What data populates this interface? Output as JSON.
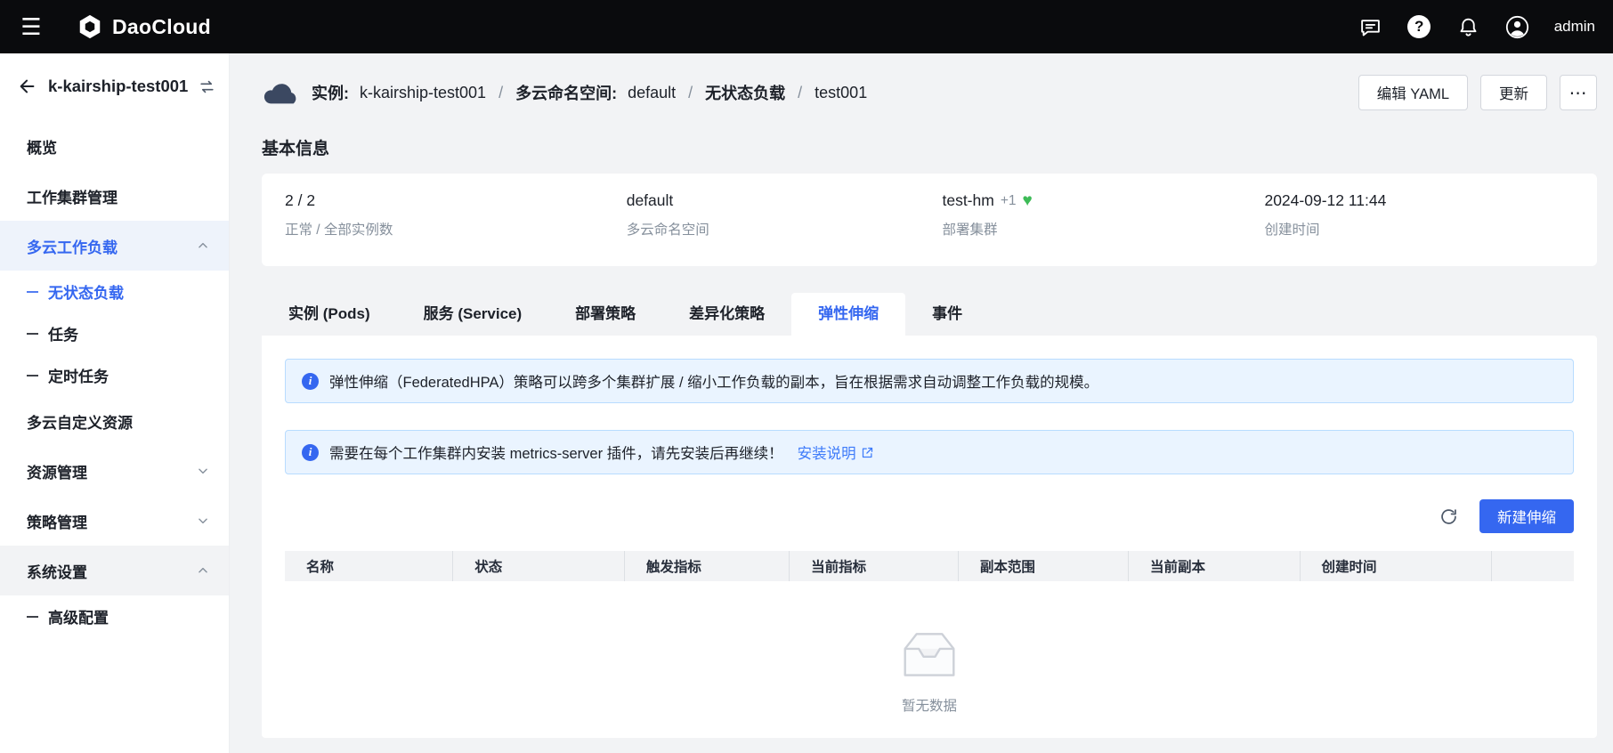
{
  "colors": {
    "accent": "#3567f0",
    "link": "#3e7bfa",
    "success_green": "#3dbb57",
    "topbar_bg": "#0a0b0d",
    "alert_bg": "#eaf4ff"
  },
  "icons": {
    "menu": "☰",
    "more": "⋯",
    "heart": "♥"
  },
  "topbar": {
    "brand": "DaoCloud",
    "user": "admin"
  },
  "sidebar": {
    "cluster": "k-kairship-test001",
    "items": [
      {
        "label": "概览"
      },
      {
        "label": "工作集群管理"
      },
      {
        "label": "多云工作负载"
      },
      {
        "label": "无状态负载"
      },
      {
        "label": "任务"
      },
      {
        "label": "定时任务"
      },
      {
        "label": "多云自定义资源"
      },
      {
        "label": "资源管理"
      },
      {
        "label": "策略管理"
      },
      {
        "label": "系统设置"
      },
      {
        "label": "高级配置"
      }
    ]
  },
  "header": {
    "breadcrumb": {
      "instance_label": "实例:",
      "instance_value": "k-kairship-test001",
      "separator": "/",
      "namespace_label": "多云命名空间:",
      "namespace_value": "default",
      "workload_label": "无状态负载",
      "workload_value": "test001"
    },
    "buttons": {
      "edit_yaml": "编辑 YAML",
      "update": "更新",
      "more": "⋯"
    }
  },
  "basic_info": {
    "title": "基本信息",
    "stats": [
      {
        "value": "2 / 2",
        "label": "正常 / 全部实例数"
      },
      {
        "value": "default",
        "label": "多云命名空间"
      },
      {
        "value": "test-hm",
        "extra": "+1",
        "label": "部署集群"
      },
      {
        "value": "2024-09-12 11:44",
        "label": "创建时间"
      }
    ]
  },
  "tabs": {
    "items": [
      "实例 (Pods)",
      "服务 (Service)",
      "部署策略",
      "差异化策略",
      "弹性伸缩",
      "事件"
    ],
    "active": "弹性伸缩"
  },
  "panel": {
    "alerts": [
      {
        "text": "弹性伸缩（FederatedHPA）策略可以跨多个集群扩展 / 缩小工作负载的副本，旨在根据需求自动调整工作负载的规模。"
      },
      {
        "text": "需要在每个工作集群内安装 metrics-server 插件，请先安装后再继续！",
        "link": "安装说明"
      }
    ],
    "toolbar": {
      "create": "新建伸缩"
    },
    "table": {
      "headers": [
        "名称",
        "状态",
        "触发指标",
        "当前指标",
        "副本范围",
        "当前副本",
        "创建时间"
      ]
    },
    "empty_text": "暂无数据"
  }
}
